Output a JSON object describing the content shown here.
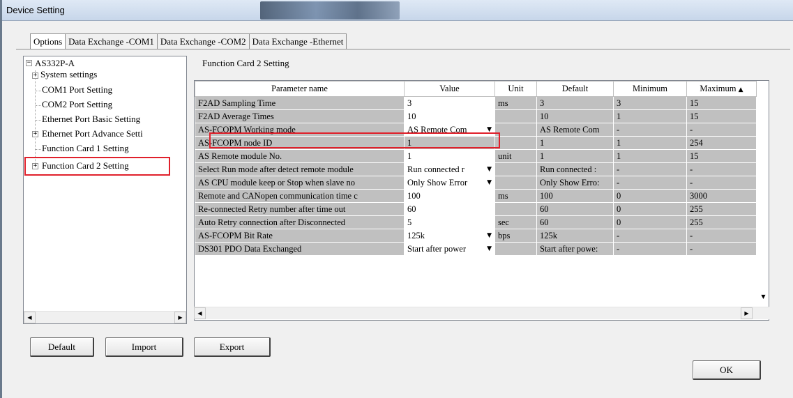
{
  "window": {
    "title": "Device Setting"
  },
  "tabs": [
    {
      "label": "Options",
      "active": true
    },
    {
      "label": "Data Exchange -COM1",
      "active": false
    },
    {
      "label": "Data Exchange -COM2",
      "active": false
    },
    {
      "label": "Data Exchange -Ethernet",
      "active": false
    }
  ],
  "tree": {
    "root": "AS332P-A",
    "items": [
      {
        "label": "System settings",
        "expandable": true
      },
      {
        "label": "COM1 Port Setting",
        "expandable": false
      },
      {
        "label": "COM2 Port Setting",
        "expandable": false
      },
      {
        "label": "Ethernet Port Basic Setting",
        "expandable": false
      },
      {
        "label": "Ethernet Port Advance Setti",
        "expandable": true
      },
      {
        "label": "Function Card 1 Setting",
        "expandable": false
      },
      {
        "label": "Function Card 2 Setting",
        "expandable": true,
        "selected": true
      }
    ]
  },
  "main": {
    "section_title": "Function Card 2 Setting"
  },
  "grid": {
    "columns": [
      "Parameter name",
      "Value",
      "Unit",
      "Default",
      "Minimum",
      "Maximum"
    ],
    "rows": [
      {
        "name": "F2AD Sampling Time",
        "value": "3",
        "dropdown": false,
        "unit": "ms",
        "default": "3",
        "min": "3",
        "max": "15"
      },
      {
        "name": "F2AD Average Times",
        "value": "10",
        "dropdown": false,
        "unit": "",
        "default": "10",
        "min": "1",
        "max": "15"
      },
      {
        "name": "AS-FCOPM Working mode",
        "value": "AS Remote Com",
        "dropdown": true,
        "unit": "",
        "default": "AS Remote Com",
        "min": "-",
        "max": "-",
        "highlighted": true
      },
      {
        "name": "AS-FCOPM node ID",
        "value": "1",
        "dropdown": false,
        "unit": "",
        "default": "1",
        "min": "1",
        "max": "254",
        "readonly": true
      },
      {
        "name": "AS Remote module No.",
        "value": "1",
        "dropdown": false,
        "unit": "unit",
        "default": "1",
        "min": "1",
        "max": "15"
      },
      {
        "name": "Select Run mode after detect remote module",
        "value": "Run connected r",
        "dropdown": true,
        "unit": "",
        "default": "Run connected :",
        "min": "-",
        "max": "-"
      },
      {
        "name": "AS CPU module keep or Stop when slave no",
        "value": "Only Show Error",
        "dropdown": true,
        "unit": "",
        "default": "Only Show Erro:",
        "min": "-",
        "max": "-"
      },
      {
        "name": "Remote and CANopen communication time c",
        "value": "100",
        "dropdown": false,
        "unit": "ms",
        "default": "100",
        "min": "0",
        "max": "3000"
      },
      {
        "name": "Re-connected Retry number after time out",
        "value": "60",
        "dropdown": false,
        "unit": "",
        "default": "60",
        "min": "0",
        "max": "255"
      },
      {
        "name": "Auto Retry connection after Disconnected",
        "value": "5",
        "dropdown": false,
        "unit": "sec",
        "default": "60",
        "min": "0",
        "max": "255"
      },
      {
        "name": "AS-FCOPM Bit Rate",
        "value": "125k",
        "dropdown": true,
        "unit": "bps",
        "default": "125k",
        "min": "-",
        "max": "-"
      },
      {
        "name": "DS301 PDO Data Exchanged",
        "value": "Start after power",
        "dropdown": true,
        "unit": "",
        "default": "Start after powe:",
        "min": "-",
        "max": "-"
      }
    ]
  },
  "buttons": {
    "default": "Default",
    "import": "Import",
    "export": "Export",
    "ok": "OK"
  },
  "colors": {
    "highlight": "#e0202b",
    "grid_gray": "#c0c0c0"
  }
}
